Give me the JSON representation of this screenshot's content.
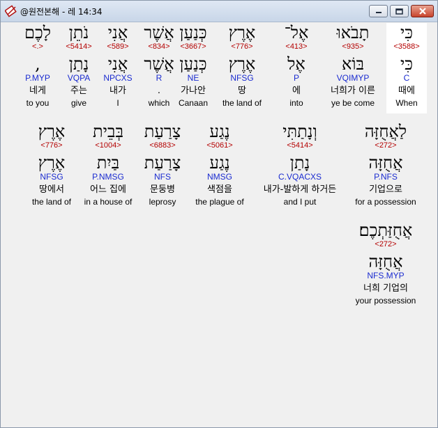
{
  "window": {
    "title": "@원전본해 - 레 14:34",
    "controls": {
      "minimize": "minimize-icon",
      "maximize": "maximize-icon",
      "close": "close-icon"
    }
  },
  "rows": [
    [
      {
        "hebrew": "כִּי",
        "strong": "<3588>",
        "lemma": "כִּי",
        "parse": "C",
        "korean": "때에",
        "english": "When",
        "highlight": true
      },
      {
        "hebrew": "תָבֹאוּ",
        "strong": "<935>",
        "lemma": "בּוֹא",
        "parse": "VQIMYP",
        "korean": "너희가 이른",
        "english": "ye be come"
      },
      {
        "hebrew": "אֶל־",
        "strong": "<413>",
        "lemma": "אֶל",
        "parse": "P",
        "korean": "에",
        "english": "into"
      },
      {
        "hebrew": "אֶרֶץ",
        "strong": "<776>",
        "lemma": "אֶרֶץ",
        "parse": "NFSG",
        "korean": "땅",
        "english": "the land of"
      },
      {
        "hebrew": "כְּנַעַן",
        "strong": "<3667>",
        "lemma": "כְּנַעַן",
        "parse": "NE",
        "korean": "가나안",
        "english": "Canaan"
      },
      {
        "hebrew": "אֲשֶׁר",
        "strong": "<834>",
        "lemma": "אֲשֶׁר",
        "parse": "R",
        "korean": ".",
        "english": "which"
      },
      {
        "hebrew": "אֲנִי",
        "strong": "<589>",
        "lemma": "אֲנִי",
        "parse": "NPCXS",
        "korean": "내가",
        "english": "I"
      },
      {
        "hebrew": "נֹתֵן",
        "strong": "<5414>",
        "lemma": "נָתַן",
        "parse": "VQPA",
        "korean": "주는",
        "english": "give"
      },
      {
        "hebrew": "לָכֶם",
        "strong": "<.>",
        "lemma": ",",
        "parse": "P.MYP",
        "korean": "네게",
        "english": "to you"
      }
    ],
    [
      {
        "hebrew": "לַאֲחֻזָּה",
        "strong": "<272>",
        "lemma": "אֲחֻזָּה",
        "parse": "P.NFS",
        "korean": "기업으로",
        "english": "for a possession"
      },
      {
        "hebrew": "וְנָתַתִּי",
        "strong": "<5414>",
        "lemma": "נָתַן",
        "parse": "C.VQACXS",
        "korean": "내가-발하게 하거든",
        "english": "and I put"
      },
      {
        "hebrew": "נֶגַע",
        "strong": "<5061>",
        "lemma": "נֶגַע",
        "parse": "NMSG",
        "korean": "색점을",
        "english": "the plague of"
      },
      {
        "hebrew": "צָרַעַת",
        "strong": "<6883>",
        "lemma": "צָרַעַת",
        "parse": "NFS",
        "korean": "문둥병",
        "english": "leprosy"
      },
      {
        "hebrew": "בְּבֵית",
        "strong": "<1004>",
        "lemma": "בַּיִת",
        "parse": "P.NMSG",
        "korean": "어느 집에",
        "english": "in a house of"
      },
      {
        "hebrew": "אֶרֶץ",
        "strong": "<776>",
        "lemma": "אֶרֶץ",
        "parse": "NFSG",
        "korean": "땅에서",
        "english": "the land of"
      }
    ],
    [
      {
        "hebrew": "אֲחֻזַּתְכֶם׃",
        "strong": "<272>",
        "lemma": "אֲחֻזָּה",
        "parse": "NFS.MYP",
        "korean": "너희 기업의",
        "english": "your possession"
      }
    ]
  ]
}
